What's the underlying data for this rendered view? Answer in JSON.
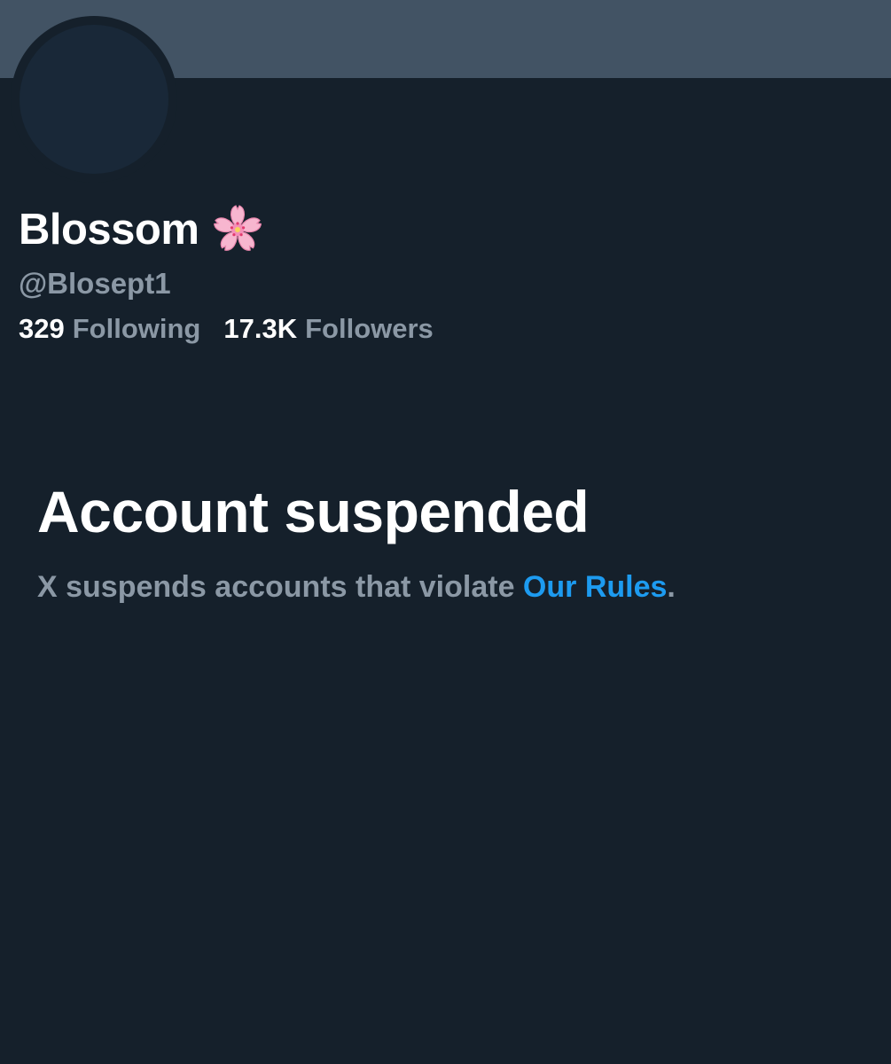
{
  "profile": {
    "display_name": "Blossom",
    "name_emoji_icon": "cherry-blossom-icon",
    "handle": "@Blosept1",
    "following_count": "329",
    "following_label": "Following",
    "followers_count": "17.3K",
    "followers_label": "Followers"
  },
  "suspension": {
    "title": "Account suspended",
    "description_prefix": "X suspends accounts that violate ",
    "rules_link_text": "Our Rules",
    "description_suffix": "."
  },
  "colors": {
    "background": "#15202b",
    "banner": "#425364",
    "avatar": "#192838",
    "secondary_text": "#8b98a5",
    "link": "#1d9bf0"
  }
}
